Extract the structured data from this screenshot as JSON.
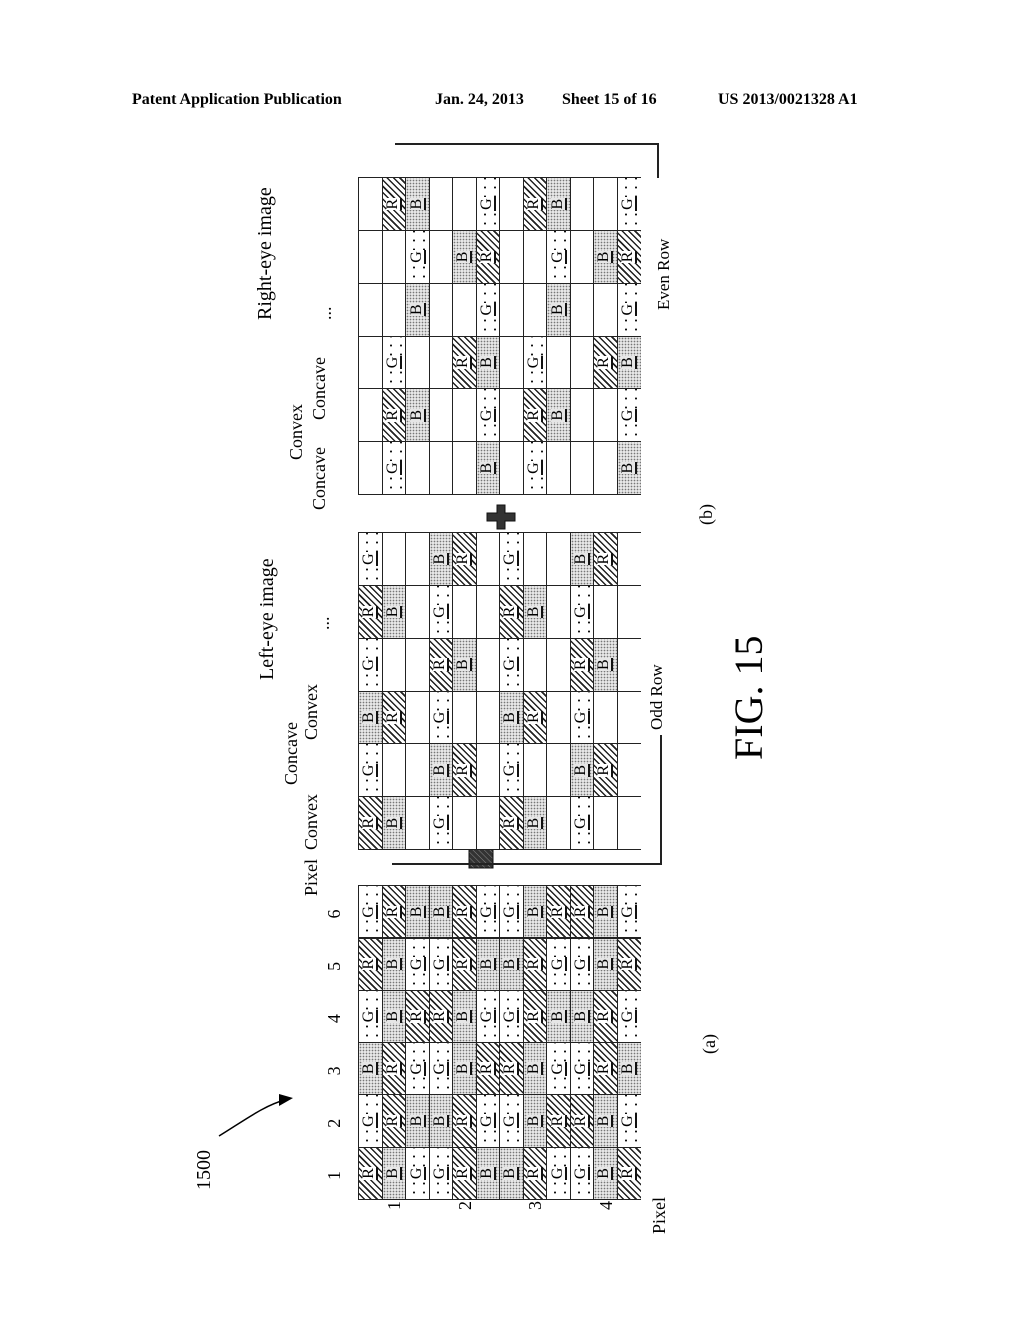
{
  "header": {
    "publication": "Patent Application Publication",
    "date": "Jan. 24, 2013",
    "sheet": "Sheet 15 of 16",
    "number": "US 2013/0021328 A1"
  },
  "figure": {
    "reference": "1500",
    "caption": "FIG. 15",
    "panel_a": {
      "label": "(a)",
      "pixel_axis_label": "Pixel",
      "row_axis_label": "Pixel",
      "column_numbers": [
        "1",
        "2",
        "3",
        "4",
        "5",
        "6"
      ],
      "row_numbers": [
        "1",
        "2",
        "3",
        "4"
      ],
      "rows": [
        [
          "RBG",
          "GRB",
          "BRG",
          "GBR",
          "RBG",
          "GRB"
        ],
        [
          "GRB",
          "BRG",
          "GBR",
          "RBG",
          "GRB",
          "BRG"
        ],
        [
          "BRG",
          "GBR",
          "RBG",
          "GRB",
          "BRG",
          "GBR"
        ],
        [
          "GBR",
          "RBG",
          "GRB",
          "BRG",
          "GBR",
          "RBG"
        ]
      ]
    },
    "panel_b": {
      "label": "(b)",
      "operator": "+",
      "left_eye": {
        "title": "Left-eye image",
        "annotations": [
          "Convex",
          "Concave",
          "Convex",
          "..."
        ],
        "row_label": "Odd Row",
        "rows": [
          [
            "RB ",
            "G  ",
            "BR ",
            "G  ",
            "RB ",
            "G  "
          ],
          [
            "G  ",
            "BR ",
            "G  ",
            "RB ",
            "G  ",
            "BR "
          ],
          [
            "RB ",
            "G  ",
            "BR ",
            "G  ",
            "RB ",
            "G  "
          ],
          [
            "G  ",
            "BR ",
            "G  ",
            "RB ",
            "G  ",
            "BR "
          ]
        ]
      },
      "right_eye": {
        "title": "Right-eye image",
        "annotations": [
          "Concave",
          "Convex",
          "Concave",
          "..."
        ],
        "row_label": "Even Row",
        "rows": [
          [
            " G ",
            " RB",
            " G ",
            "  B",
            "  G",
            " RB"
          ],
          [
            "  B",
            "  G",
            " RB",
            "  G",
            " BR",
            "  G"
          ],
          [
            " G ",
            " RB",
            " G ",
            "  B",
            "  G",
            " RB"
          ],
          [
            "  B",
            "  G",
            " RB",
            "  G",
            " BR",
            "  G"
          ]
        ]
      }
    },
    "subpixel_legend": {
      "R": "hatched",
      "G": "plus-dotted",
      "B": "stippled"
    }
  }
}
